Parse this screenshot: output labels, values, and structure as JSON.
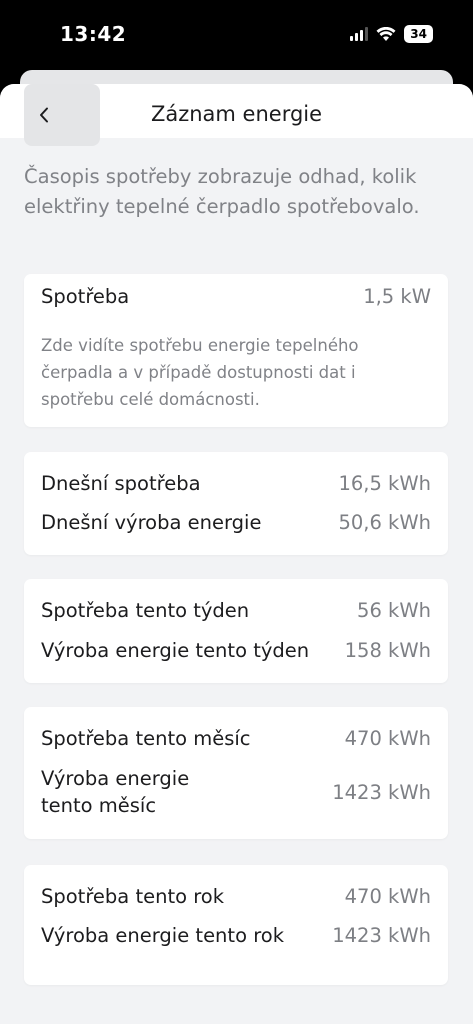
{
  "status_bar": {
    "time": "13:42",
    "battery": "34"
  },
  "navbar": {
    "title": "Záznam energie",
    "back_icon": "chevron-left-icon"
  },
  "intro": "Časopis spotřeby zobrazuje odhad, kolik elektřiny tepelné čerpadlo spotřebovalo.",
  "current": {
    "label": "Spotřeba",
    "value": "1,5 kW",
    "description": "Zde vidíte spotřebu energie tepelného čerpadla a v případě dostupnosti dat i spotřebu celé domácnosti."
  },
  "today": {
    "consumption_label": "Dnešní spotřeba",
    "consumption_value": "16,5 kWh",
    "production_label": "Dnešní výroba energie",
    "production_value": "50,6 kWh"
  },
  "week": {
    "consumption_label": "Spotřeba tento týden",
    "consumption_value": "56 kWh",
    "production_label": "Výroba energie tento týden",
    "production_value": "158 kWh"
  },
  "month": {
    "consumption_label": "Spotřeba tento měsíc",
    "consumption_value": "470 kWh",
    "production_label_line1": "Výroba energie",
    "production_label_line2": "tento měsíc",
    "production_value": "1423 kWh"
  },
  "year": {
    "consumption_label": "Spotřeba tento rok",
    "consumption_value": "470 kWh",
    "production_label": "Výroba energie tento rok",
    "production_value": "1423 kWh"
  }
}
